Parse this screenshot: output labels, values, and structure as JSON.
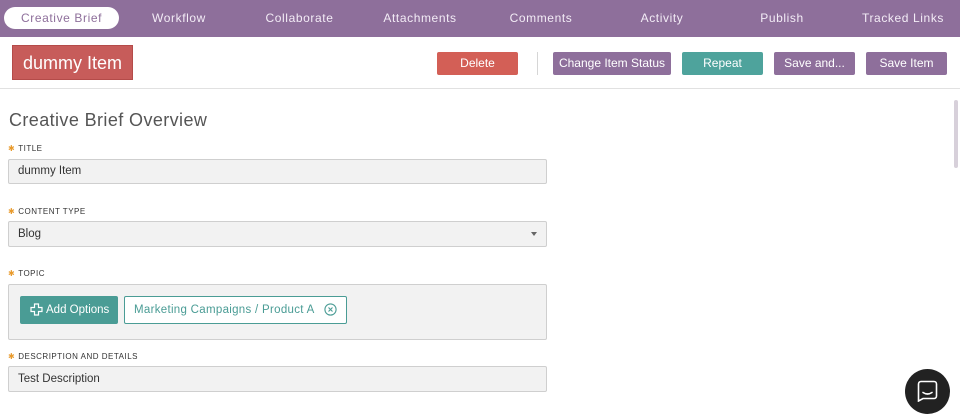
{
  "tabs": [
    {
      "label": "Creative Brief",
      "active": true
    },
    {
      "label": "Workflow"
    },
    {
      "label": "Collaborate"
    },
    {
      "label": "Attachments"
    },
    {
      "label": "Comments"
    },
    {
      "label": "Activity"
    },
    {
      "label": "Publish"
    },
    {
      "label": "Tracked Links"
    }
  ],
  "header": {
    "item_title": "dummy Item",
    "delete_label": "Delete",
    "change_status_label": "Change Item Status",
    "repeat_label": "Repeat",
    "save_and_label": "Save and...",
    "save_item_label": "Save Item"
  },
  "main": {
    "section_title": "Creative Brief Overview",
    "required_mark": "✱",
    "title_label": "TITLE",
    "title_value": "dummy Item",
    "content_type_label": "CONTENT TYPE",
    "content_type_value": "Blog",
    "topic_label": "TOPIC",
    "add_options_label": "Add Options",
    "topic_chip": "Marketing Campaigns / Product A",
    "description_label": "DESCRIPTION AND DETAILS",
    "description_value": "Test Description"
  },
  "colors": {
    "brand_purple": "#8e6f9b",
    "delete_red": "#d35f56",
    "teal": "#4ea39c",
    "required_orange": "#e89a2c"
  },
  "icons": [
    "plus-outline-icon",
    "remove-circle-icon",
    "chevron-down-icon",
    "chat-icon"
  ]
}
